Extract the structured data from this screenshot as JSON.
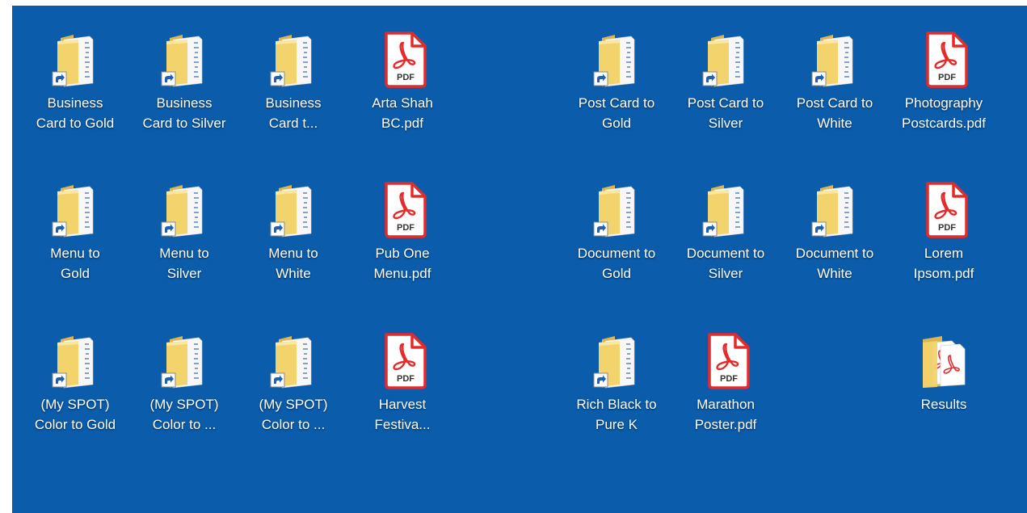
{
  "desktop": {
    "background_color": "#0b5cab",
    "icons": [
      {
        "type": "folder-shortcut",
        "label": "Business\nCard to Gold"
      },
      {
        "type": "folder-shortcut",
        "label": "Business\nCard to Silver"
      },
      {
        "type": "folder-shortcut",
        "label": "Business\nCard t..."
      },
      {
        "type": "pdf",
        "label": "Arta Shah\nBC.pdf",
        "badge": "PDF"
      },
      {
        "type": "folder-shortcut",
        "label": "Post Card to\nGold"
      },
      {
        "type": "folder-shortcut",
        "label": "Post Card to\nSilver"
      },
      {
        "type": "folder-shortcut",
        "label": "Post Card to\nWhite"
      },
      {
        "type": "pdf",
        "label": "Photography\nPostcards.pdf",
        "badge": "PDF"
      },
      {
        "type": "folder-shortcut",
        "label": "Menu to\nGold"
      },
      {
        "type": "folder-shortcut",
        "label": "Menu to\nSilver"
      },
      {
        "type": "folder-shortcut",
        "label": "Menu to\nWhite"
      },
      {
        "type": "pdf",
        "label": "Pub One\nMenu.pdf",
        "badge": "PDF"
      },
      {
        "type": "folder-shortcut",
        "label": "Document to\nGold"
      },
      {
        "type": "folder-shortcut",
        "label": "Document to\nSilver"
      },
      {
        "type": "folder-shortcut",
        "label": "Document to\nWhite"
      },
      {
        "type": "pdf",
        "label": "Lorem\nIpsom.pdf",
        "badge": "PDF"
      },
      {
        "type": "folder-shortcut",
        "label": "(My SPOT)\nColor to Gold"
      },
      {
        "type": "folder-shortcut",
        "label": "(My SPOT)\nColor to ..."
      },
      {
        "type": "folder-shortcut",
        "label": "(My SPOT)\nColor to ..."
      },
      {
        "type": "pdf",
        "label": "Harvest\nFestiva...",
        "badge": "PDF"
      },
      {
        "type": "folder-shortcut",
        "label": "Rich Black to\nPure K"
      },
      {
        "type": "pdf",
        "label": "Marathon\nPoster.pdf",
        "badge": "PDF"
      },
      {
        "type": "folder-pdf",
        "label": "Results"
      }
    ]
  }
}
